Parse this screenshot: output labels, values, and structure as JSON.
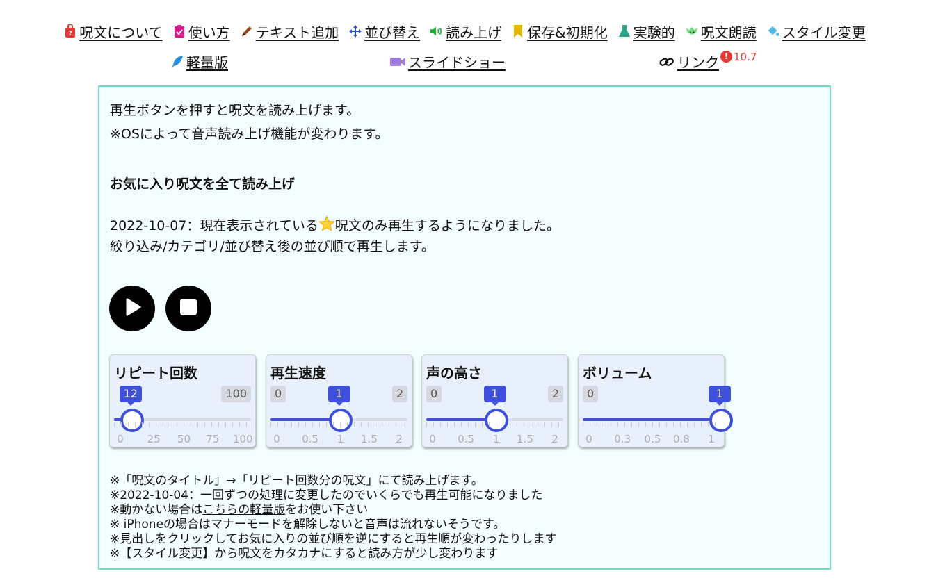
{
  "nav": {
    "items": [
      {
        "label": "呪文について",
        "icon": "question-bag-icon"
      },
      {
        "label": "使い方",
        "icon": "clipboard-check-icon"
      },
      {
        "label": "テキスト追加",
        "icon": "pen-icon"
      },
      {
        "label": "並び替え",
        "icon": "move-arrows-icon"
      },
      {
        "label": "読み上げ",
        "icon": "speaker-icon"
      },
      {
        "label": "保存&初期化",
        "icon": "bookmark-icon"
      },
      {
        "label": "実験的",
        "icon": "flask-icon"
      },
      {
        "label": "呪文朗読",
        "icon": "character-icon"
      },
      {
        "label": "スタイル変更",
        "icon": "paint-bucket-icon"
      }
    ],
    "row2": [
      {
        "label": "軽量版",
        "icon": "feather-icon"
      },
      {
        "label": "スライドショー",
        "icon": "video-icon"
      },
      {
        "label": "リンク",
        "icon": "link-icon"
      }
    ],
    "version": "10.7",
    "version_mark": "!"
  },
  "intro": {
    "line1": "再生ボタンを押すと呪文を読み上げます。",
    "line2": "※OSによって音声読み上げ機能が変わります。"
  },
  "section": {
    "heading": "お気に入り呪文を全て読み上げ",
    "update_prefix": "2022-10-07：現在表示されている",
    "update_suffix": "呪文のみ再生するようになりました。",
    "line2": "絞り込み/カテゴリ/並び替え後の並び順で再生します。"
  },
  "sliders": [
    {
      "title": "リピート回数",
      "min": "0",
      "max": "100",
      "value": "12",
      "fraction": 0.12,
      "grid": [
        "0",
        "25",
        "50",
        "75",
        "100"
      ]
    },
    {
      "title": "再生速度",
      "min": "0",
      "max": "2",
      "value": "1",
      "fraction": 0.5,
      "grid": [
        "0",
        "0.5",
        "1",
        "1.5",
        "2"
      ]
    },
    {
      "title": "声の高さ",
      "min": "0",
      "max": "2",
      "value": "1",
      "fraction": 0.5,
      "grid": [
        "0",
        "0.5",
        "1",
        "1.5",
        "2"
      ]
    },
    {
      "title": "ボリューム",
      "min": "0",
      "max": "1",
      "value": "1",
      "fraction": 1.0,
      "grid": [
        "0",
        "0.3",
        "0.5",
        "0.8",
        "1"
      ]
    }
  ],
  "notes": {
    "n1": "※「呪文のタイトル」→「リピート回数分の呪文」にて読み上げます。",
    "n2": "※2022-10-04：一回ずつの処理に変更したのでいくらでも再生可能になりました",
    "n3_prefix": "※動かない場合は",
    "n3_link": "こちらの軽量版",
    "n3_suffix": "をお使い下さい",
    "n4": "※ iPhoneの場合はマナーモードを解除しないと音声は流れないそうです。",
    "n5": "※見出しをクリックしてお気に入りの並び順を逆にすると再生順が変わったりします",
    "n6": "※【スタイル変更】から呪文をカタカナにすると読み方が少し変わります"
  },
  "colors": {
    "accent": "#3f51d8",
    "panel_border": "#6fd8c6",
    "badge": "#e53935"
  }
}
